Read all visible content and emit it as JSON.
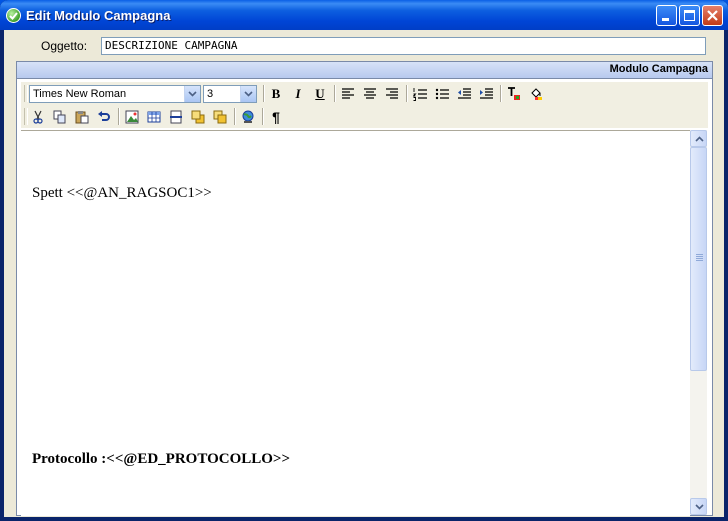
{
  "window": {
    "title": "Edit Modulo Campagna"
  },
  "form": {
    "subject_label": "Oggetto:",
    "subject_value": "DESCRIZIONE CAMPAGNA"
  },
  "panel": {
    "title": "Modulo Campagna"
  },
  "toolbar": {
    "font_name": "Times New Roman",
    "font_size": "3",
    "bold": "B",
    "italic": "I",
    "underline": "U",
    "pilcrow": "¶"
  },
  "editor": {
    "line1": "Spett <<@AN_RAGSOC1>>",
    "line2": "Protocollo :<<@ED_PROTOCOLLO>>"
  },
  "colors": {
    "titlebar": "#0054e3",
    "client": "#ece9d8",
    "panel_header": "#c7d6f3"
  }
}
